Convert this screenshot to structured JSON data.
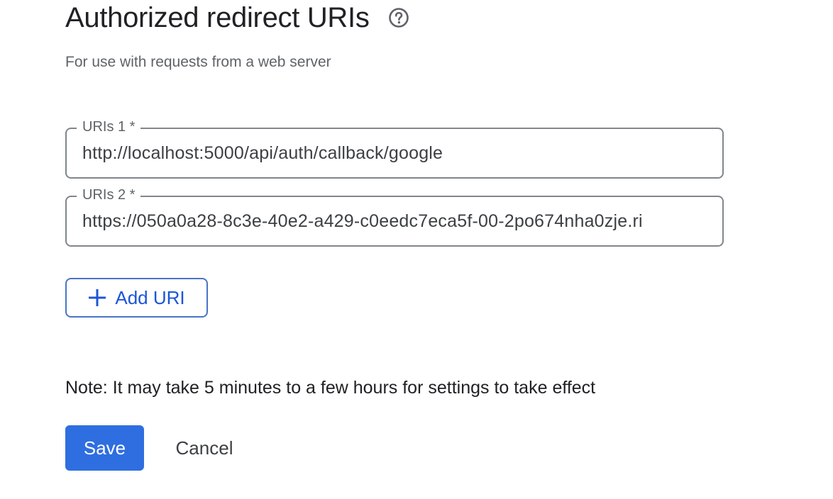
{
  "section": {
    "title": "Authorized redirect URIs",
    "help_icon": "help-circle-icon",
    "subtitle": "For use with requests from a web server"
  },
  "uris": [
    {
      "label": "URIs 1 *",
      "value": "http://localhost:5000/api/auth/callback/google"
    },
    {
      "label": "URIs 2 *",
      "value": "https://050a0a28-8c3e-40e2-a429-c0eedc7eca5f-00-2po674nha0zje.ri"
    }
  ],
  "actions": {
    "add_uri_label": "Add URI",
    "add_icon": "plus-icon",
    "note": "Note: It may take 5 minutes to a few hours for settings to take effect",
    "save_label": "Save",
    "cancel_label": "Cancel"
  },
  "colors": {
    "primary": "#2f6ee0",
    "primary_text": "#1a56d6",
    "outline": "#80868b",
    "muted_text": "#5f6368"
  }
}
